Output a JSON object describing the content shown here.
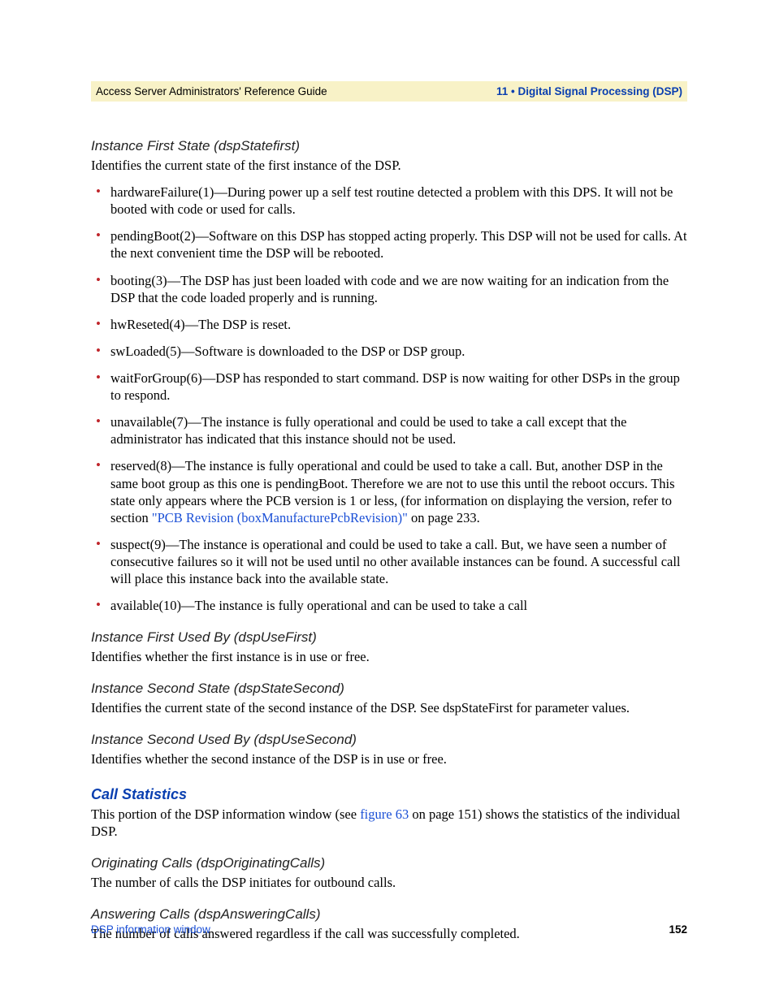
{
  "header": {
    "left": "Access Server Administrators' Reference Guide",
    "right": "11 • Digital Signal Processing (DSP)"
  },
  "sections": {
    "instanceFirstState": {
      "title": "Instance First State (dspStatefirst)",
      "intro": "Identifies the current state of the first instance of the DSP.",
      "items": {
        "i0": "hardwareFailure(1)—During power up a self test routine detected a problem with this DPS. It will not be booted with code or used for calls.",
        "i1": "pendingBoot(2)—Software on this DSP has stopped acting properly. This DSP will not be used for calls. At the next convenient time the DSP will be rebooted.",
        "i2": "booting(3)—The DSP has just been loaded with code and we are now waiting for an indication from the DSP that the code loaded properly and is running.",
        "i3": "hwReseted(4)—The DSP is reset.",
        "i4": "swLoaded(5)—Software is downloaded to the DSP or DSP group.",
        "i5": "waitForGroup(6)—DSP has responded to start command. DSP is now waiting for other DSPs in the group to respond.",
        "i6": "unavailable(7)—The instance is fully operational and could be used to take a call except that the administrator has indicated that this instance should not be used.",
        "i7_pre": "reserved(8)—The instance is fully operational and could be used to take a call. But, another DSP in the same boot group as this one is pendingBoot. Therefore we are not to use this until the reboot occurs. This state only appears where the PCB version is 1 or less, (for information on displaying the version, refer to section ",
        "i7_link": "\"PCB Revision (boxManufacturePcbRevision)\"",
        "i7_post": " on page 233.",
        "i8": "suspect(9)—The instance is operational and could be used to take a call. But, we have seen a number of consecutive failures so it will not be used until no other available instances can be found. A successful call will place this instance back into the available state.",
        "i9": "available(10)—The instance is fully operational and can be used to take a call"
      }
    },
    "instanceFirstUsedBy": {
      "title": "Instance First Used By (dspUseFirst)",
      "body": "Identifies whether the first instance is in use or free."
    },
    "instanceSecondState": {
      "title": "Instance Second State (dspStateSecond)",
      "body": "Identifies the current state of the second instance of the DSP. See dspStateFirst for parameter values."
    },
    "instanceSecondUsedBy": {
      "title": "Instance Second Used By (dspUseSecond)",
      "body": "Identifies whether the second instance of the DSP is in use or free."
    },
    "callStatistics": {
      "title": "Call Statistics",
      "intro_pre": "This portion of the DSP information window (see ",
      "intro_link": "figure 63",
      "intro_post": " on page 151) shows the statistics of the individual DSP."
    },
    "originatingCalls": {
      "title": "Originating Calls (dspOriginatingCalls)",
      "body": "The number of calls the DSP initiates for outbound calls."
    },
    "answeringCalls": {
      "title": "Answering Calls (dspAnsweringCalls)",
      "body": "The number of calls answered regardless if the call was successfully completed."
    }
  },
  "footer": {
    "left": "DSP information window",
    "right": "152"
  }
}
